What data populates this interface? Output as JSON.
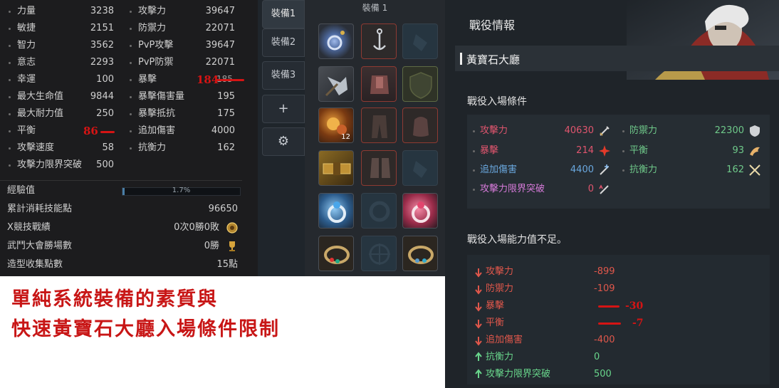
{
  "stats": {
    "left": [
      {
        "label": "力量",
        "value": "3238"
      },
      {
        "label": "敏捷",
        "value": "2151"
      },
      {
        "label": "智力",
        "value": "3562"
      },
      {
        "label": "意志",
        "value": "2293"
      },
      {
        "label": "幸運",
        "value": "100"
      },
      {
        "label": "最大生命值",
        "value": "9844"
      },
      {
        "label": "最大耐力值",
        "value": "250"
      },
      {
        "label": "平衡",
        "value": "86"
      },
      {
        "label": "攻擊速度",
        "value": "58"
      },
      {
        "label": "攻擊力限界突破",
        "value": "500"
      }
    ],
    "right": [
      {
        "label": "攻擊力",
        "value": "39647"
      },
      {
        "label": "防禦力",
        "value": "22071"
      },
      {
        "label": "PvP攻擊",
        "value": "39647"
      },
      {
        "label": "PvP防禦",
        "value": "22071"
      },
      {
        "label": "暴擊",
        "value": "184"
      },
      {
        "label": "暴擊傷害量",
        "value": "195"
      },
      {
        "label": "暴擊抵抗",
        "value": "175"
      },
      {
        "label": "追加傷害",
        "value": "4000"
      },
      {
        "label": "抗衡力",
        "value": "162"
      }
    ],
    "crit_struck": "185"
  },
  "lower": {
    "exp_label": "經驗值",
    "exp_value": "1.7%",
    "exp_fraction": 0.017,
    "skill_points_label": "累計消耗技能點",
    "skill_points_value": "96650",
    "pvp_label": "X競技戰績",
    "pvp_value": "0次0勝0敗",
    "arena_label": "武鬥大會勝場數",
    "arena_value": "0勝",
    "collection_label": "造型收集點數",
    "collection_value": "15點"
  },
  "tabs": [
    "裝備1",
    "裝備2",
    "裝備3",
    "+",
    "⚙"
  ],
  "equip": {
    "title": "裝備 1",
    "stack_count": "12"
  },
  "annotation": {
    "line1": "單純系統裝備的素質與",
    "line2": "快速黃寶石大廳入場條件限制"
  },
  "battle": {
    "title": "戰役情報",
    "dungeon": "黃寶石大廳",
    "req_heading": "戰役入場條件",
    "requirements": [
      {
        "label": "攻擊力",
        "value": "40630",
        "value_color": "#e0556e",
        "icon": "sword-icon"
      },
      {
        "label": "防禦力",
        "value": "22300",
        "value_color": "#6fc98a",
        "icon": "shield-icon"
      },
      {
        "label": "暴擊",
        "value": "214",
        "value_color": "#e0556e",
        "icon": "crit-burst-icon"
      },
      {
        "label": "平衡",
        "value": "93",
        "value_color": "#6fc98a",
        "icon": "balance-wing-icon"
      },
      {
        "label": "追加傷害",
        "value": "4400",
        "value_color": "#6aa8df",
        "icon": "sword-plus-icon"
      },
      {
        "label": "抗衡力",
        "value": "162",
        "value_color": "#6fc98a",
        "icon": "crossed-swords-icon"
      },
      {
        "label": "攻擊力限界突破",
        "value": "0",
        "value_color": "#e0556e",
        "icon": "limit-break-icon"
      }
    ],
    "deficit_heading": "戰役入場能力值不足。",
    "deficits": [
      {
        "label": "攻擊力",
        "value": "-899",
        "direction": "down"
      },
      {
        "label": "防禦力",
        "value": "-109",
        "direction": "down"
      },
      {
        "label": "暴擊",
        "value": "",
        "direction": "down",
        "note": "-30"
      },
      {
        "label": "平衡",
        "value": "",
        "direction": "down",
        "note": "-7"
      },
      {
        "label": "追加傷害",
        "value": "-400",
        "direction": "down"
      },
      {
        "label": "抗衡力",
        "value": "0",
        "direction": "up"
      },
      {
        "label": "攻擊力限界突破",
        "value": "500",
        "direction": "up"
      }
    ]
  }
}
